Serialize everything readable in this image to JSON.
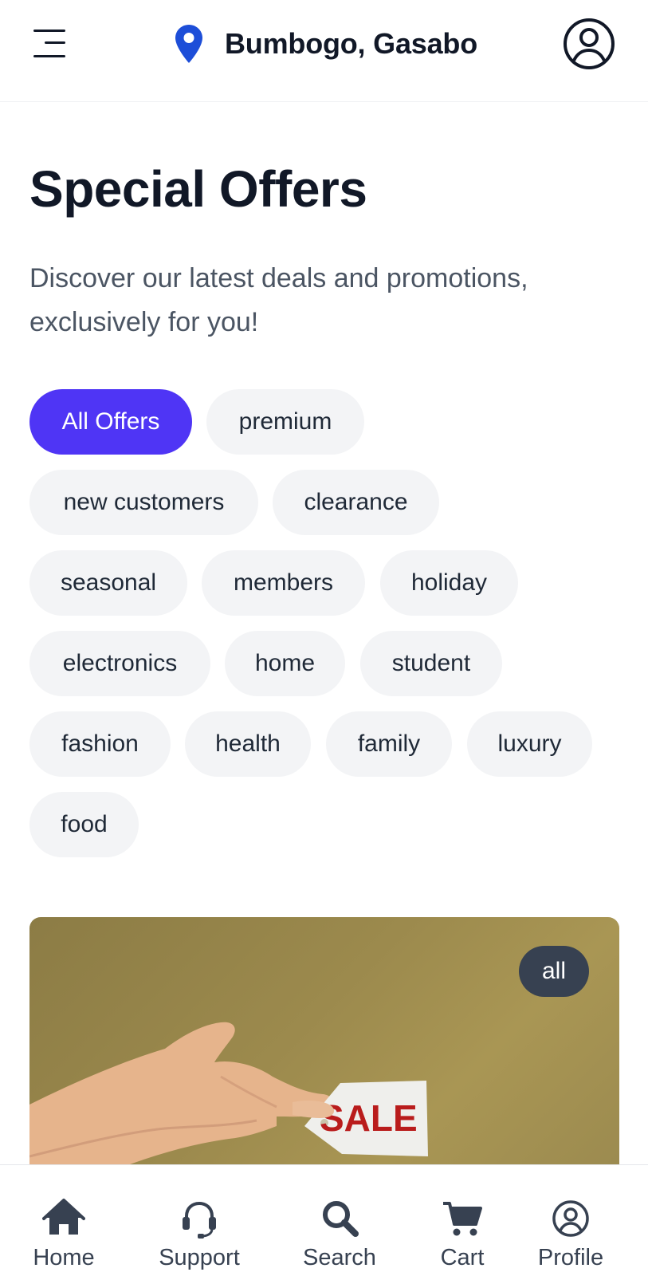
{
  "header": {
    "location": "Bumbogo, Gasabo"
  },
  "page": {
    "title": "Special Offers",
    "subtitle": "Discover our latest deals and promotions, exclusively for you!"
  },
  "filters": [
    {
      "label": "All Offers",
      "active": true
    },
    {
      "label": "premium",
      "active": false
    },
    {
      "label": "new customers",
      "active": false
    },
    {
      "label": "clearance",
      "active": false
    },
    {
      "label": "seasonal",
      "active": false
    },
    {
      "label": "members",
      "active": false
    },
    {
      "label": "holiday",
      "active": false
    },
    {
      "label": "electronics",
      "active": false
    },
    {
      "label": "home",
      "active": false
    },
    {
      "label": "student",
      "active": false
    },
    {
      "label": "fashion",
      "active": false
    },
    {
      "label": "health",
      "active": false
    },
    {
      "label": "family",
      "active": false
    },
    {
      "label": "luxury",
      "active": false
    },
    {
      "label": "food",
      "active": false
    }
  ],
  "offer_card": {
    "badge": "all",
    "image_text": "SALE"
  },
  "bottom_nav": [
    {
      "label": "Home",
      "icon": "home-icon"
    },
    {
      "label": "Support",
      "icon": "headset-icon"
    },
    {
      "label": "Search",
      "icon": "search-icon"
    },
    {
      "label": "Cart",
      "icon": "cart-icon"
    },
    {
      "label": "Profile",
      "icon": "user-circle-icon"
    }
  ],
  "colors": {
    "accent": "#4f35f5",
    "pin": "#1d4ed8",
    "chip_bg": "#f3f4f6",
    "badge_bg": "#374151"
  }
}
